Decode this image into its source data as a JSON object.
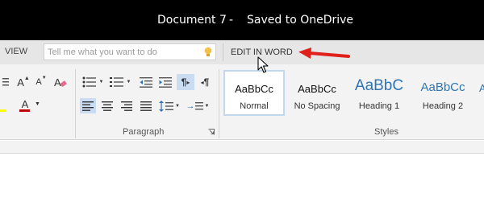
{
  "titlebar": {
    "document": "Document 7",
    "separator": "-",
    "status": "Saved to OneDrive"
  },
  "menu": {
    "view_tab": "VIEW",
    "search_placeholder": "Tell me what you want to do",
    "edit_in_word": "EDIT IN WORD"
  },
  "ribbon": {
    "font": {
      "grow": "A",
      "shrink": "A",
      "font_color": "A"
    },
    "paragraph": {
      "label": "Paragraph",
      "ltr_mark": "¶",
      "rtl_mark": "¶",
      "indent_arrow": "→"
    },
    "styles": {
      "label": "Styles",
      "items": [
        {
          "preview": "AaBbCc",
          "name": "Normal"
        },
        {
          "preview": "AaBbCc",
          "name": "No Spacing"
        },
        {
          "preview": "AaBbC",
          "name": "Heading 1"
        },
        {
          "preview": "AaBbCc",
          "name": "Heading 2"
        }
      ]
    }
  },
  "colors": {
    "heading": "#2e74b5",
    "arrow": "#e0201b",
    "font_color_bar": "#c00000",
    "highlight_bar": "#ffff00"
  }
}
